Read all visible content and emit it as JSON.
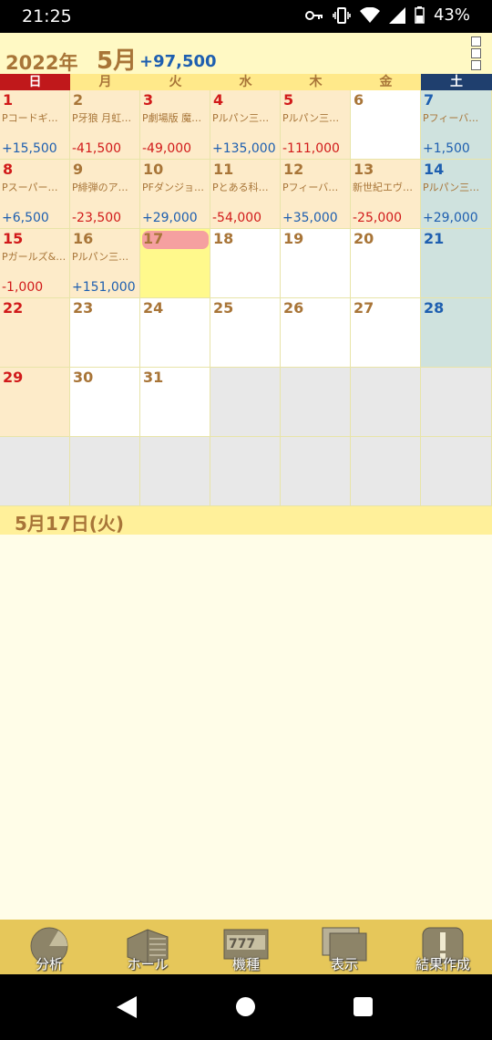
{
  "status_bar": {
    "time": "21:25",
    "battery": "43%"
  },
  "header": {
    "year": "2022年",
    "month": "5月",
    "month_total": "+97,500"
  },
  "weekdays": [
    "日",
    "月",
    "火",
    "水",
    "木",
    "金",
    "土"
  ],
  "calendar": {
    "weeks": [
      [
        {
          "day": "1",
          "machine": "Pコードギ…",
          "amount": "+15,500"
        },
        {
          "day": "2",
          "machine": "P牙狼 月虹…",
          "amount": "-41,500"
        },
        {
          "day": "3",
          "machine": "P劇場版 魔…",
          "amount": "-49,000"
        },
        {
          "day": "4",
          "machine": "Pルパン三…",
          "amount": "+135,000"
        },
        {
          "day": "5",
          "machine": "Pルパン三…",
          "amount": "-111,000"
        },
        {
          "day": "6",
          "machine": "",
          "amount": ""
        },
        {
          "day": "7",
          "machine": "Pフィーバ…",
          "amount": "+1,500"
        }
      ],
      [
        {
          "day": "8",
          "machine": "Pスーパー…",
          "amount": "+6,500"
        },
        {
          "day": "9",
          "machine": "P緋弾のア…",
          "amount": "-23,500"
        },
        {
          "day": "10",
          "machine": "PFダンジョ…",
          "amount": "+29,000"
        },
        {
          "day": "11",
          "machine": "Pとある科…",
          "amount": "-54,000"
        },
        {
          "day": "12",
          "machine": "Pフィーバ…",
          "amount": "+35,000"
        },
        {
          "day": "13",
          "machine": "新世紀エヴ…",
          "amount": "-25,000"
        },
        {
          "day": "14",
          "machine": "Pルパン三…",
          "amount": "+29,000"
        }
      ],
      [
        {
          "day": "15",
          "machine": "Pガールズ&…",
          "amount": "-1,000"
        },
        {
          "day": "16",
          "machine": "Pルパン三…",
          "amount": "+151,000"
        },
        {
          "day": "17",
          "machine": "",
          "amount": ""
        },
        {
          "day": "18",
          "machine": "",
          "amount": ""
        },
        {
          "day": "19",
          "machine": "",
          "amount": ""
        },
        {
          "day": "20",
          "machine": "",
          "amount": ""
        },
        {
          "day": "21",
          "machine": "",
          "amount": ""
        }
      ],
      [
        {
          "day": "22",
          "machine": "",
          "amount": ""
        },
        {
          "day": "23",
          "machine": "",
          "amount": ""
        },
        {
          "day": "24",
          "machine": "",
          "amount": ""
        },
        {
          "day": "25",
          "machine": "",
          "amount": ""
        },
        {
          "day": "26",
          "machine": "",
          "amount": ""
        },
        {
          "day": "27",
          "machine": "",
          "amount": ""
        },
        {
          "day": "28",
          "machine": "",
          "amount": ""
        }
      ],
      [
        {
          "day": "29",
          "machine": "",
          "amount": ""
        },
        {
          "day": "30",
          "machine": "",
          "amount": ""
        },
        {
          "day": "31",
          "machine": "",
          "amount": ""
        },
        {
          "day": "",
          "machine": "",
          "amount": ""
        },
        {
          "day": "",
          "machine": "",
          "amount": ""
        },
        {
          "day": "",
          "machine": "",
          "amount": ""
        },
        {
          "day": "",
          "machine": "",
          "amount": ""
        }
      ],
      [
        {
          "day": "",
          "machine": "",
          "amount": ""
        },
        {
          "day": "",
          "machine": "",
          "amount": ""
        },
        {
          "day": "",
          "machine": "",
          "amount": ""
        },
        {
          "day": "",
          "machine": "",
          "amount": ""
        },
        {
          "day": "",
          "machine": "",
          "amount": ""
        },
        {
          "day": "",
          "machine": "",
          "amount": ""
        },
        {
          "day": "",
          "machine": "",
          "amount": ""
        }
      ]
    ]
  },
  "selected_date": "5月17日(火)",
  "toolbar": {
    "analysis": "分析",
    "hall": "ホール",
    "machine": "機種",
    "display": "表示",
    "results": "結果作成"
  },
  "colors": {
    "accent_brown": "#a87538",
    "positive_blue": "#1e5fb0",
    "negative_red": "#d11a1a",
    "today_highlight": "#fff98c",
    "toolbar_gold": "#e6c75a"
  }
}
